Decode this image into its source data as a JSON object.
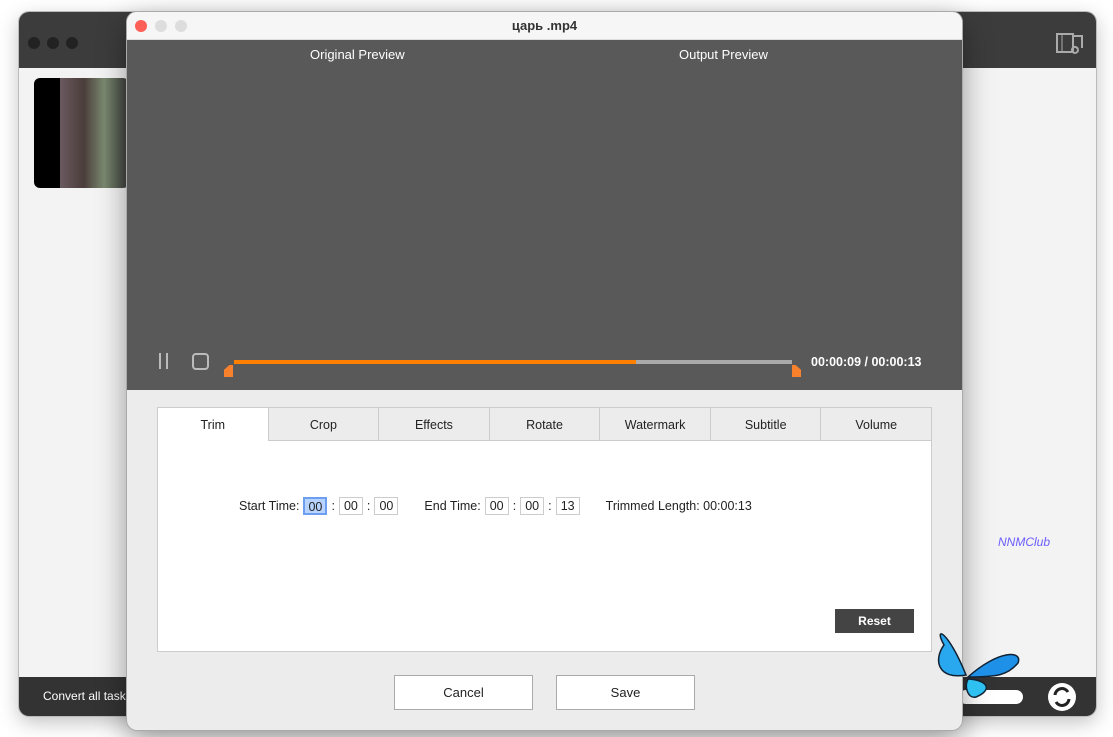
{
  "background_window": {
    "footer_label": "Convert all tasks",
    "watermark": "NNMClub"
  },
  "dialog": {
    "title": "царь .mp4",
    "original_preview": "Original Preview",
    "output_preview": "Output  Preview",
    "time_display": "00:00:09 / 00:00:13",
    "progress": 0.72,
    "tabs": [
      "Trim",
      "Crop",
      "Effects",
      "Rotate",
      "Watermark",
      "Subtitle",
      "Volume"
    ],
    "active_tab": "Trim",
    "trim": {
      "start_label": "Start Time:",
      "start": [
        "00",
        "00",
        "00"
      ],
      "end_label": "End Time:",
      "end": [
        "00",
        "00",
        "13"
      ],
      "length_label": "Trimmed Length: 00:00:13"
    },
    "reset": "Reset",
    "cancel": "Cancel",
    "save": "Save"
  },
  "colors": {
    "accent": "#ff7f00",
    "video_bg": "#595959"
  }
}
